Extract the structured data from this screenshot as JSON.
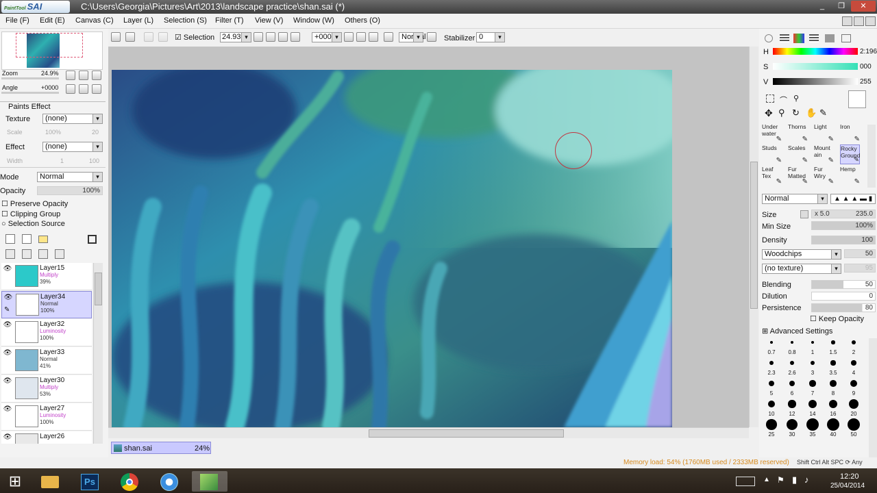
{
  "window": {
    "app_logo": "PaintTool SAI",
    "logo_small": "PaintTool",
    "logo_big": "SAI",
    "title": "C:\\Users\\Georgia\\Pictures\\Art\\2013\\landscape practice\\shan.sai (*)",
    "min": "_",
    "max": "❐",
    "close": "✕"
  },
  "menu": [
    "File (F)",
    "Edit (E)",
    "Canvas (C)",
    "Layer (L)",
    "Selection (S)",
    "Filter (T)",
    "View (V)",
    "Window (W)",
    "Others (O)"
  ],
  "navigator": {
    "zoom_label": "Zoom",
    "zoom_value": "24.9%",
    "angle_label": "Angle",
    "angle_value": "+0000"
  },
  "paints_effect": {
    "header": "Paints Effect",
    "texture_label": "Texture",
    "texture_value": "(none)",
    "scale_label": "Scale",
    "scale_value": "100%",
    "scale_num": "20",
    "effect_label": "Effect",
    "effect_value": "(none)",
    "width_label": "Width",
    "width_value": "1",
    "width_num": "100"
  },
  "layer_props": {
    "mode_label": "Mode",
    "mode_value": "Normal",
    "opacity_label": "Opacity",
    "opacity_value": "100%",
    "preserve_opacity": "Preserve Opacity",
    "clipping_group": "Clipping Group",
    "selection_source": "Selection Source"
  },
  "layers": [
    {
      "name": "Layer15",
      "mode": "Multiply",
      "opacity": "39%",
      "thumb_color": "#2cc9c9",
      "selected": false
    },
    {
      "name": "Layer34",
      "mode": "Normal",
      "opacity": "100%",
      "thumb_color": "#ffffff",
      "selected": true
    },
    {
      "name": "Layer32",
      "mode": "Luminosity",
      "opacity": "100%",
      "thumb_color": "#ffffff",
      "selected": false
    },
    {
      "name": "Layer33",
      "mode": "Normal",
      "opacity": "41%",
      "thumb_color": "#7fb7d0",
      "selected": false
    },
    {
      "name": "Layer30",
      "mode": "Multiply",
      "opacity": "53%",
      "thumb_color": "#dfe6ee",
      "selected": false
    },
    {
      "name": "Layer27",
      "mode": "Luminosity",
      "opacity": "100%",
      "thumb_color": "#ffffff",
      "selected": false
    },
    {
      "name": "Layer26",
      "mode": "",
      "opacity": "",
      "thumb_color": "#e8e8e8",
      "selected": false
    }
  ],
  "toolbar": {
    "selection_label": "Selection",
    "zoom_value": "24.93%",
    "angle_value": "+000°",
    "blend_value": "Normal",
    "stabilizer_label": "Stabilizer",
    "stabilizer_value": "0"
  },
  "file_tab": {
    "name": "shan.sai",
    "zoom": "24%"
  },
  "color": {
    "h_label": "H",
    "h_value": "2:196",
    "s_label": "S",
    "s_value": "000",
    "v_label": "V",
    "v_value": "255",
    "primary": "#ffffff",
    "secondary": "#4a9cf0"
  },
  "brushes": [
    {
      "label": "Under water"
    },
    {
      "label": "Thorns"
    },
    {
      "label": "Light"
    },
    {
      "label": "Iron"
    },
    {
      "label": "Studs"
    },
    {
      "label": "Scales"
    },
    {
      "label": "Mount ain"
    },
    {
      "label": "Rocky Ground"
    },
    {
      "label": "Leaf Tex"
    },
    {
      "label": "Fur Matted"
    },
    {
      "label": "Fur Wiry"
    },
    {
      "label": "Hemp"
    }
  ],
  "brush_settings": {
    "blend_mode": "Normal",
    "size_label": "Size",
    "size_multiplier": "x 5.0",
    "size_value": "235.0",
    "min_size_label": "Min Size",
    "min_size_value": "100%",
    "density_label": "Density",
    "density_value": "100",
    "texture1": "Woodchips",
    "texture1_value": "50",
    "texture2": "(no texture)",
    "texture2_value": "95",
    "blending_label": "Blending",
    "blending_value": "50",
    "dilution_label": "Dilution",
    "dilution_value": "0",
    "persistence_label": "Persistence",
    "persistence_value": "80",
    "keep_opacity": "Keep Opacity",
    "advanced": "Advanced Settings"
  },
  "brush_sizes": [
    "0.7",
    "0.8",
    "1",
    "1.5",
    "2",
    "2.3",
    "2.6",
    "3",
    "3.5",
    "4",
    "5",
    "6",
    "7",
    "8",
    "9",
    "10",
    "12",
    "14",
    "16",
    "20",
    "25",
    "30",
    "35",
    "40",
    "50"
  ],
  "status": {
    "memory": "Memory load: 54% (1760MB used / 2333MB reserved)",
    "keys": "Shift Ctrl Alt SPC ⟳ Any"
  },
  "taskbar": {
    "time": "12:20",
    "date": "25/04/2014",
    "ps_label": "Ps"
  }
}
